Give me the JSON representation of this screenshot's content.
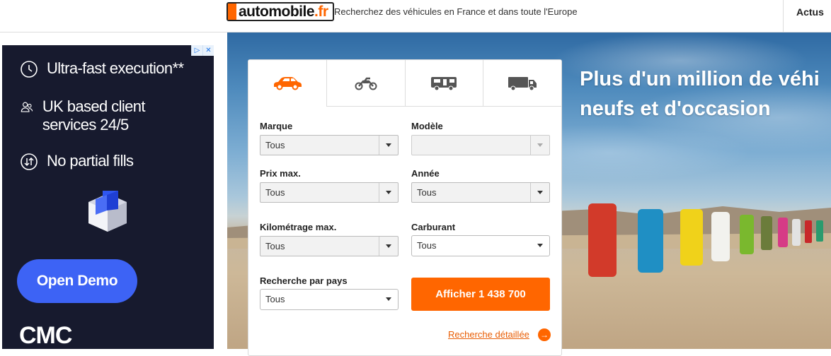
{
  "header": {
    "logo_text": "automobile",
    "logo_tld": ".fr",
    "tagline": "Recherchez des véhicules en France et dans toute l'Europe",
    "nav_actus": "Actus"
  },
  "ad": {
    "corner_icons": [
      "ad-info-icon",
      "ad-close-icon"
    ],
    "features": [
      {
        "icon": "clock-icon",
        "text": "Ultra-fast execution**"
      },
      {
        "icon": "people-icon",
        "text": "UK based client services 24/5"
      },
      {
        "icon": "no-partial-fills-icon",
        "text": "No partial fills"
      }
    ],
    "cta": "Open Demo",
    "brand": "CMC"
  },
  "hero": {
    "title_line1": "Plus d'un million de véhi",
    "title_line2": "neufs et d'occasion"
  },
  "search": {
    "tabs": [
      {
        "icon": "car-icon",
        "active": true
      },
      {
        "icon": "motorcycle-icon",
        "active": false
      },
      {
        "icon": "camper-icon",
        "active": false
      },
      {
        "icon": "truck-icon",
        "active": false
      }
    ],
    "fields": {
      "marque": {
        "label": "Marque",
        "value": "Tous"
      },
      "modele": {
        "label": "Modèle",
        "value": ""
      },
      "prix": {
        "label": "Prix max.",
        "value": "Tous"
      },
      "annee": {
        "label": "Année",
        "value": "Tous"
      },
      "km": {
        "label": "Kilométrage max.",
        "value": "Tous"
      },
      "carburant": {
        "label": "Carburant",
        "value": "Tous"
      },
      "pays": {
        "label": "Recherche par pays",
        "value": "Tous"
      }
    },
    "submit_label": "Afficher 1 438 700",
    "detail_link": "Recherche détaillée"
  },
  "colors": {
    "accent": "#ff6600",
    "ad_background": "#171a2e",
    "ad_button": "#3d63f5"
  }
}
